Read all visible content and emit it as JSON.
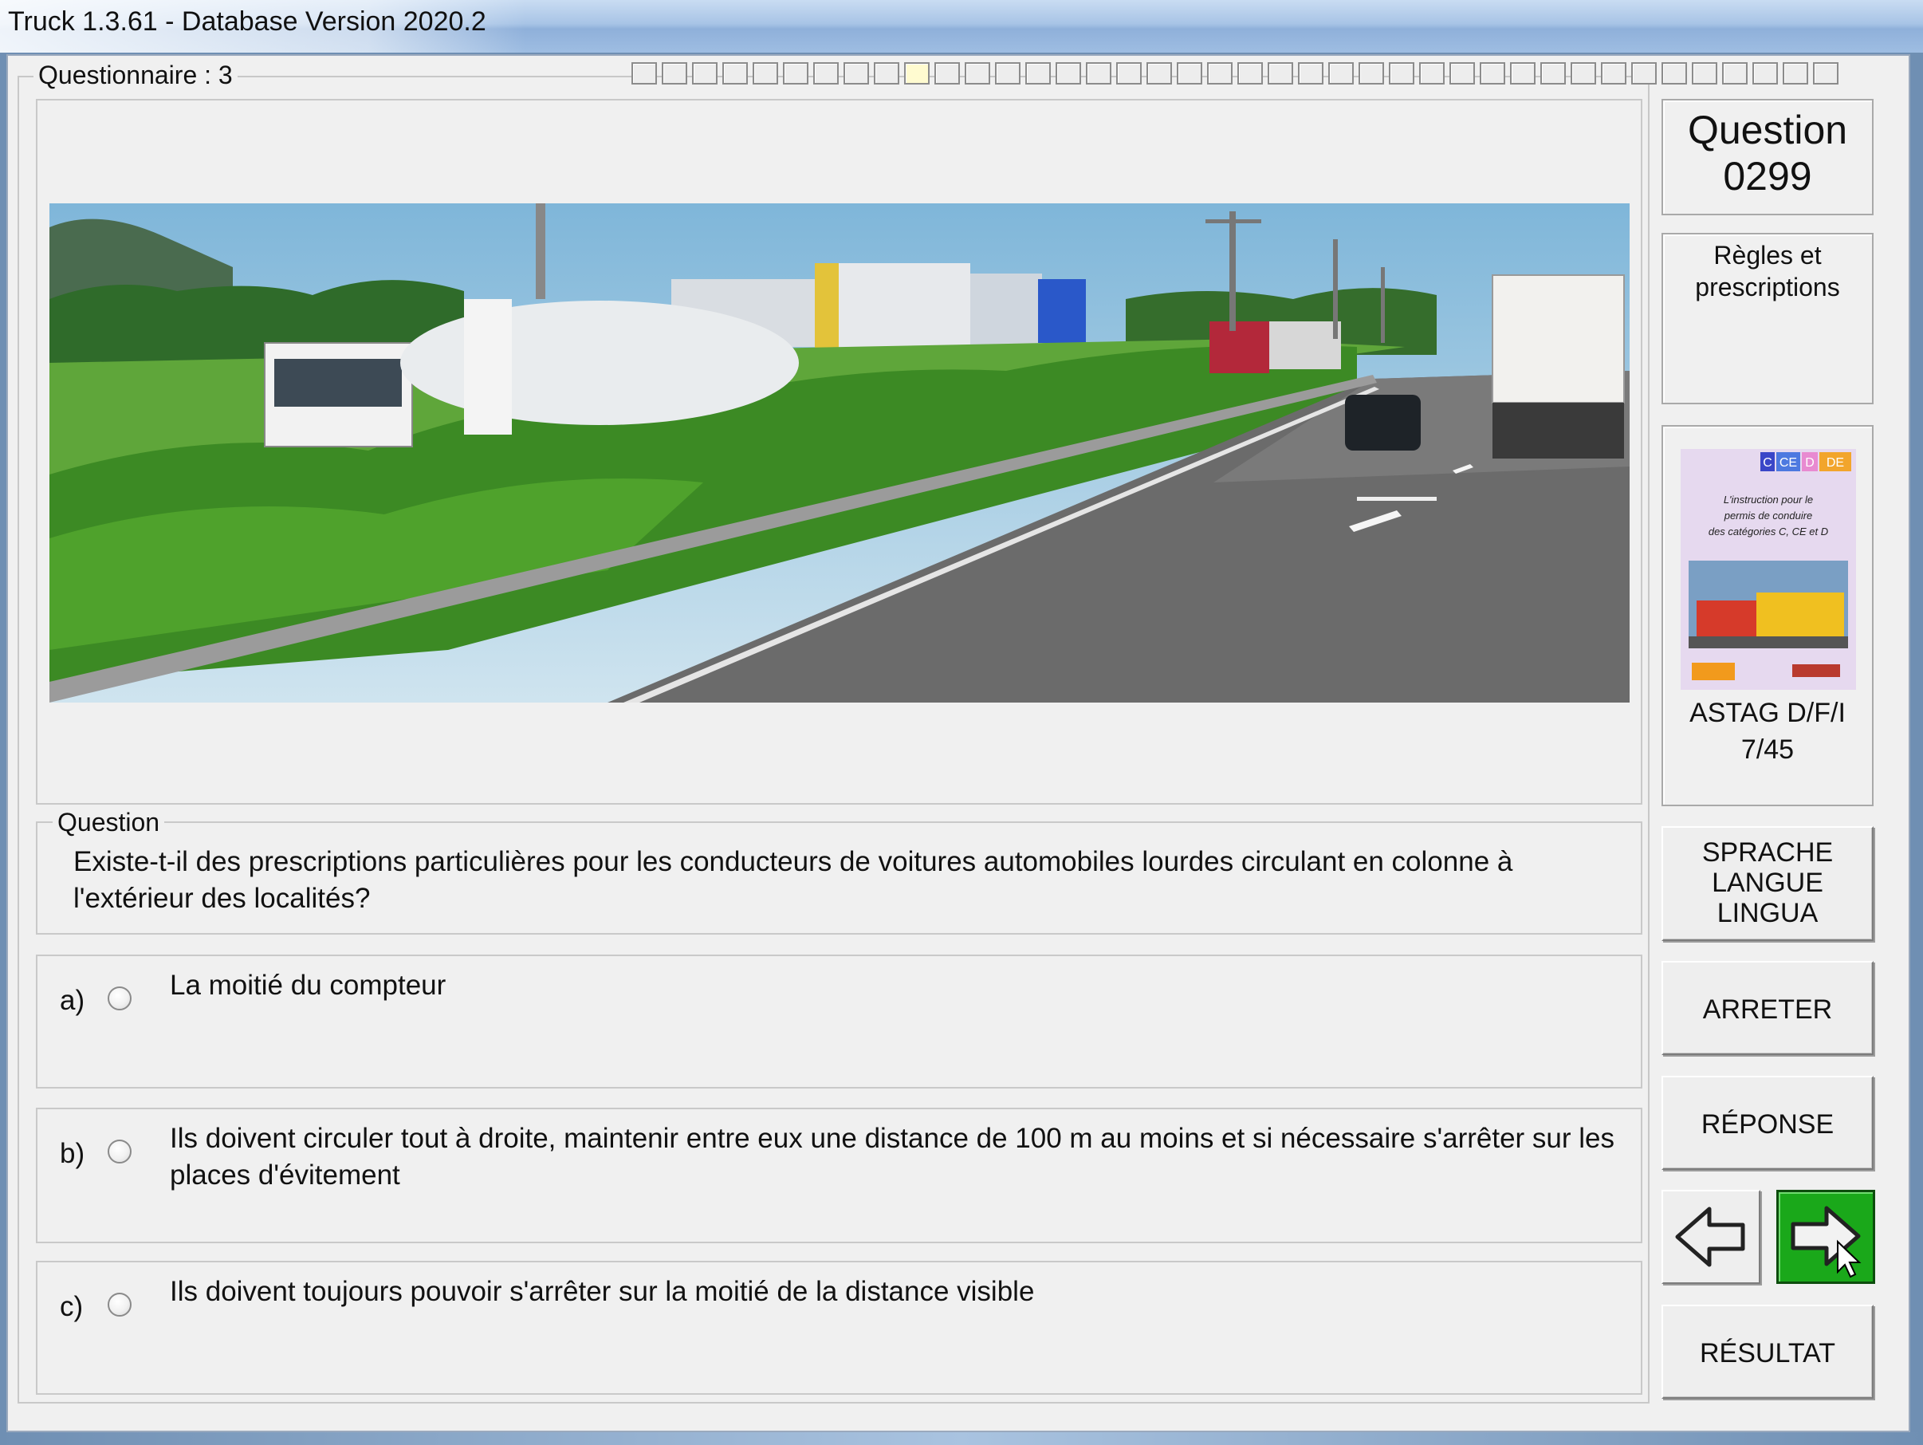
{
  "window": {
    "title": "Truck 1.3.61 - Database Version 2020.2"
  },
  "questionnaire": {
    "label": "Questionnaire : 3",
    "progress_total": 40,
    "progress_current": 10
  },
  "question_group": {
    "label": "Question",
    "text": "Existe-t-il des prescriptions particulières pour les conducteurs de voitures automobiles lourdes circulant en colonne à l'extérieur des localités?"
  },
  "answers": [
    {
      "letter": "a)",
      "text": "La moitié du compteur"
    },
    {
      "letter": "b)",
      "text": "Ils doivent circuler tout à droite, maintenir entre eux une distance de 100 m au moins et si nécessaire s'arrêter sur les places d'évitement"
    },
    {
      "letter": "c)",
      "text": "Ils doivent toujours pouvoir s'arrêter sur la moitié de la distance visible"
    }
  ],
  "sidebar": {
    "question_label": "Question",
    "question_number": "0299",
    "category_line1": "Règles et",
    "category_line2": "prescriptions",
    "book_caption_line1": "ASTAG D/F/I",
    "book_caption_line2": "7/45",
    "book_cover": {
      "badges": [
        "C",
        "CE",
        "D",
        "DE"
      ],
      "text_lines": [
        "L'instruction pour le",
        "permis de conduire",
        "des catégories C, CE et D"
      ]
    }
  },
  "buttons": {
    "language_line1": "SPRACHE",
    "language_line2": "LANGUE",
    "language_line3": "LINGUA",
    "stop": "ARRETER",
    "response": "RÉPONSE",
    "result": "RÉSULTAT",
    "prev_icon": "arrow-left-icon",
    "next_icon": "arrow-right-icon"
  },
  "colors": {
    "next_button": "#1aa81a",
    "window_bg": "#f0f0f0"
  }
}
